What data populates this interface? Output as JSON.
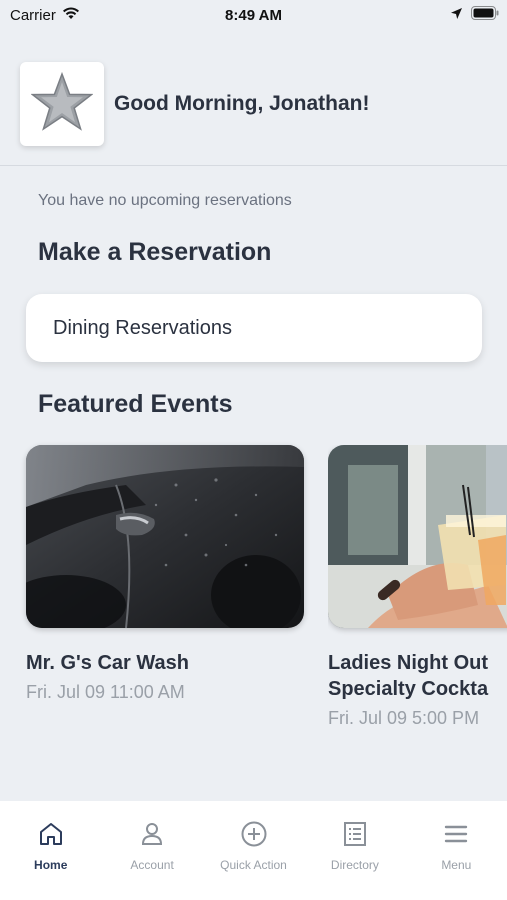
{
  "status": {
    "carrier": "Carrier",
    "time": "8:49 AM"
  },
  "header": {
    "greeting": "Good Morning, Jonathan!"
  },
  "reservations": {
    "empty_text": "You have no upcoming reservations",
    "section_title": "Make a Reservation",
    "dining_label": "Dining Reservations"
  },
  "events": {
    "section_title": "Featured Events",
    "items": [
      {
        "title": "Mr. G's Car Wash",
        "date": "Fri. Jul 09 11:00 AM"
      },
      {
        "title_line1": "Ladies Night Out",
        "title_line2": "Specialty Cockta",
        "date": "Fri. Jul 09 5:00 PM"
      }
    ]
  },
  "tabs": [
    {
      "label": "Home",
      "icon": "home-icon",
      "active": true
    },
    {
      "label": "Account",
      "icon": "account-icon"
    },
    {
      "label": "Quick Action",
      "icon": "plus-circle-icon"
    },
    {
      "label": "Directory",
      "icon": "directory-icon"
    },
    {
      "label": "Menu",
      "icon": "menu-icon"
    }
  ],
  "colors": {
    "background": "#eceff3",
    "text_primary": "#2b3240",
    "text_muted": "#9aa0a8",
    "active_tab": "#2c3c5c"
  }
}
